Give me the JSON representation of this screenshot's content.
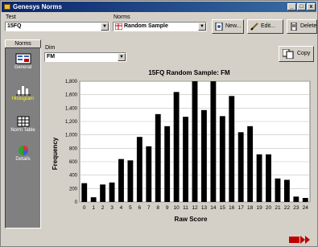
{
  "window": {
    "title": "Genesys Norms",
    "minimize": "_",
    "maximize": "□",
    "close": "x"
  },
  "test": {
    "label": "Test",
    "value": "15FQ"
  },
  "norms": {
    "label": "Norms",
    "value": "Random Sample"
  },
  "toolbar": {
    "new_label": "New...",
    "edit_label": "Edit...",
    "delete_label": "Delete"
  },
  "sidebar": {
    "tab_label": "Norms",
    "items": [
      {
        "label": "General",
        "icon": "general-icon",
        "active": false
      },
      {
        "label": "Histogram",
        "icon": "histogram-icon",
        "active": true
      },
      {
        "label": "Norm Table",
        "icon": "norm-table-icon",
        "active": false
      },
      {
        "label": "Details",
        "icon": "details-icon",
        "active": false
      }
    ]
  },
  "dim": {
    "label": "Dim",
    "value": "FM"
  },
  "copy_label": "Copy",
  "next_label": "",
  "colors": {
    "titlebar": "#0a246a",
    "bars": "#000000",
    "plot_bg": "#ffffff",
    "active_nav": "#ffff00"
  },
  "chart_data": {
    "type": "bar",
    "title": "15FQ Random Sample: FM",
    "xlabel": "Raw Score",
    "ylabel": "Frequency",
    "categories": [
      "0",
      "1",
      "2",
      "3",
      "4",
      "5",
      "6",
      "7",
      "8",
      "9",
      "10",
      "11",
      "12",
      "13",
      "14",
      "15",
      "16",
      "17",
      "18",
      "19",
      "20",
      "21",
      "22",
      "23",
      "24"
    ],
    "values": [
      280,
      70,
      260,
      290,
      640,
      620,
      970,
      830,
      1310,
      1130,
      1640,
      1270,
      1800,
      1370,
      1800,
      1280,
      1580,
      1040,
      1130,
      710,
      710,
      350,
      330,
      80,
      60
    ],
    "ylim": [
      0,
      1800
    ],
    "yticks": [
      0,
      200,
      400,
      600,
      800,
      "1,000",
      "1,200",
      "1,400",
      "1,600",
      "1,800"
    ],
    "grid": true
  }
}
